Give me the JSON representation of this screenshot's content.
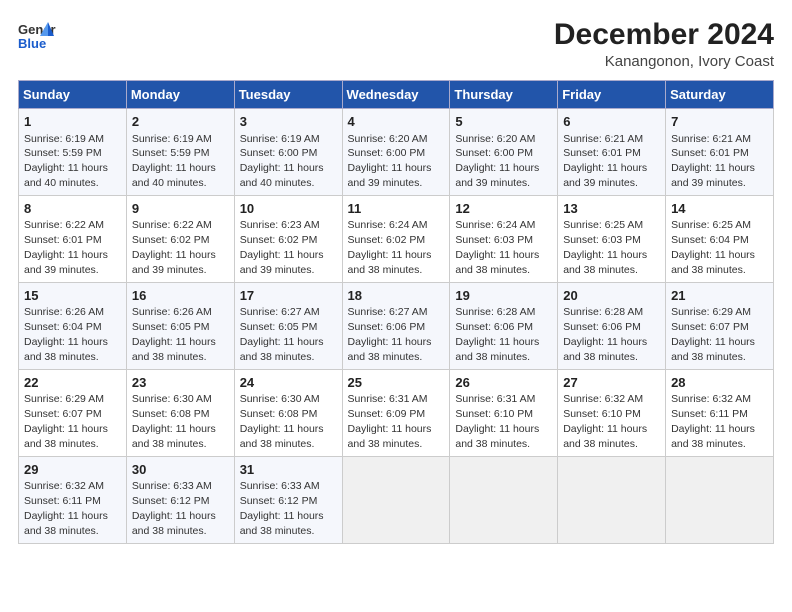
{
  "logo": {
    "general": "General",
    "blue": "Blue"
  },
  "title": "December 2024",
  "subtitle": "Kanangonon, Ivory Coast",
  "weekdays": [
    "Sunday",
    "Monday",
    "Tuesday",
    "Wednesday",
    "Thursday",
    "Friday",
    "Saturday"
  ],
  "weeks": [
    [
      {
        "day": "1",
        "sunrise": "6:19 AM",
        "sunset": "5:59 PM",
        "daylight": "11 hours and 40 minutes."
      },
      {
        "day": "2",
        "sunrise": "6:19 AM",
        "sunset": "5:59 PM",
        "daylight": "11 hours and 40 minutes."
      },
      {
        "day": "3",
        "sunrise": "6:19 AM",
        "sunset": "6:00 PM",
        "daylight": "11 hours and 40 minutes."
      },
      {
        "day": "4",
        "sunrise": "6:20 AM",
        "sunset": "6:00 PM",
        "daylight": "11 hours and 39 minutes."
      },
      {
        "day": "5",
        "sunrise": "6:20 AM",
        "sunset": "6:00 PM",
        "daylight": "11 hours and 39 minutes."
      },
      {
        "day": "6",
        "sunrise": "6:21 AM",
        "sunset": "6:01 PM",
        "daylight": "11 hours and 39 minutes."
      },
      {
        "day": "7",
        "sunrise": "6:21 AM",
        "sunset": "6:01 PM",
        "daylight": "11 hours and 39 minutes."
      }
    ],
    [
      {
        "day": "8",
        "sunrise": "6:22 AM",
        "sunset": "6:01 PM",
        "daylight": "11 hours and 39 minutes."
      },
      {
        "day": "9",
        "sunrise": "6:22 AM",
        "sunset": "6:02 PM",
        "daylight": "11 hours and 39 minutes."
      },
      {
        "day": "10",
        "sunrise": "6:23 AM",
        "sunset": "6:02 PM",
        "daylight": "11 hours and 39 minutes."
      },
      {
        "day": "11",
        "sunrise": "6:24 AM",
        "sunset": "6:02 PM",
        "daylight": "11 hours and 38 minutes."
      },
      {
        "day": "12",
        "sunrise": "6:24 AM",
        "sunset": "6:03 PM",
        "daylight": "11 hours and 38 minutes."
      },
      {
        "day": "13",
        "sunrise": "6:25 AM",
        "sunset": "6:03 PM",
        "daylight": "11 hours and 38 minutes."
      },
      {
        "day": "14",
        "sunrise": "6:25 AM",
        "sunset": "6:04 PM",
        "daylight": "11 hours and 38 minutes."
      }
    ],
    [
      {
        "day": "15",
        "sunrise": "6:26 AM",
        "sunset": "6:04 PM",
        "daylight": "11 hours and 38 minutes."
      },
      {
        "day": "16",
        "sunrise": "6:26 AM",
        "sunset": "6:05 PM",
        "daylight": "11 hours and 38 minutes."
      },
      {
        "day": "17",
        "sunrise": "6:27 AM",
        "sunset": "6:05 PM",
        "daylight": "11 hours and 38 minutes."
      },
      {
        "day": "18",
        "sunrise": "6:27 AM",
        "sunset": "6:06 PM",
        "daylight": "11 hours and 38 minutes."
      },
      {
        "day": "19",
        "sunrise": "6:28 AM",
        "sunset": "6:06 PM",
        "daylight": "11 hours and 38 minutes."
      },
      {
        "day": "20",
        "sunrise": "6:28 AM",
        "sunset": "6:06 PM",
        "daylight": "11 hours and 38 minutes."
      },
      {
        "day": "21",
        "sunrise": "6:29 AM",
        "sunset": "6:07 PM",
        "daylight": "11 hours and 38 minutes."
      }
    ],
    [
      {
        "day": "22",
        "sunrise": "6:29 AM",
        "sunset": "6:07 PM",
        "daylight": "11 hours and 38 minutes."
      },
      {
        "day": "23",
        "sunrise": "6:30 AM",
        "sunset": "6:08 PM",
        "daylight": "11 hours and 38 minutes."
      },
      {
        "day": "24",
        "sunrise": "6:30 AM",
        "sunset": "6:08 PM",
        "daylight": "11 hours and 38 minutes."
      },
      {
        "day": "25",
        "sunrise": "6:31 AM",
        "sunset": "6:09 PM",
        "daylight": "11 hours and 38 minutes."
      },
      {
        "day": "26",
        "sunrise": "6:31 AM",
        "sunset": "6:10 PM",
        "daylight": "11 hours and 38 minutes."
      },
      {
        "day": "27",
        "sunrise": "6:32 AM",
        "sunset": "6:10 PM",
        "daylight": "11 hours and 38 minutes."
      },
      {
        "day": "28",
        "sunrise": "6:32 AM",
        "sunset": "6:11 PM",
        "daylight": "11 hours and 38 minutes."
      }
    ],
    [
      {
        "day": "29",
        "sunrise": "6:32 AM",
        "sunset": "6:11 PM",
        "daylight": "11 hours and 38 minutes."
      },
      {
        "day": "30",
        "sunrise": "6:33 AM",
        "sunset": "6:12 PM",
        "daylight": "11 hours and 38 minutes."
      },
      {
        "day": "31",
        "sunrise": "6:33 AM",
        "sunset": "6:12 PM",
        "daylight": "11 hours and 38 minutes."
      },
      null,
      null,
      null,
      null
    ]
  ]
}
